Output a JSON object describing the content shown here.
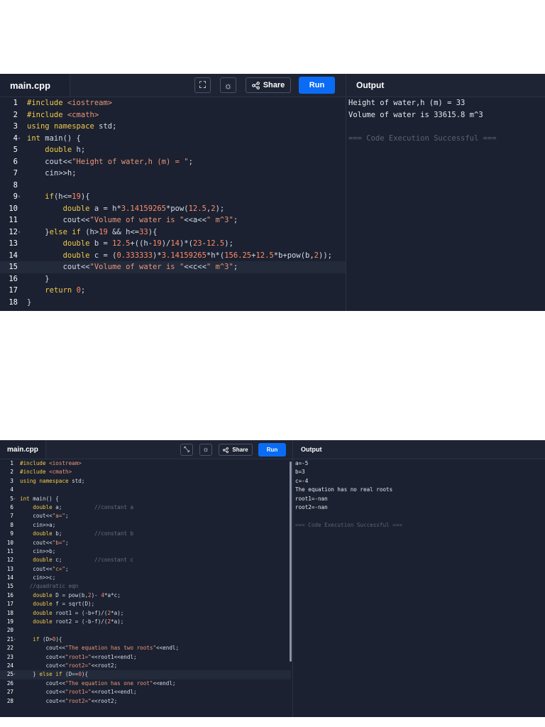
{
  "screens": [
    {
      "tab_label": "main.cpp",
      "share_label": "Share",
      "run_label": "Run",
      "output_title": "Output",
      "icons": [
        "fullscreen-icon",
        "theme-icon",
        "share-icon"
      ],
      "code_lines": [
        "#include <iostream>",
        "#include <cmath>",
        "using namespace std;",
        "int main() {",
        "    double h;",
        "    cout<<\"Height of water,h (m) = \";",
        "    cin>>h;",
        "",
        "    if(h<=19){",
        "        double a = h*3.14159265*pow(12.5,2);",
        "        cout<<\"Volume of water is \"<<a<<\" m^3\";",
        "    }else if (h>19 && h<=33){",
        "        double b = 12.5+((h-19)/14)*(23-12.5);",
        "        double c = (0.333333)*3.14159265*h*(156.25+12.5*b+pow(b,2));",
        "        cout<<\"Volume of water is \"<<c<<\" m^3\";",
        "    }",
        "    return 0;",
        "}"
      ],
      "fold_lines": [
        4,
        9,
        12
      ],
      "active_line": 15,
      "output_lines": [
        "Height of water,h (m) = 33",
        "Volume of water is 33615.8 m^3",
        "",
        "=== Code Execution Successful ==="
      ]
    },
    {
      "tab_label": "main.cpp",
      "share_label": "Share",
      "run_label": "Run",
      "output_title": "Output",
      "icons": [
        "exit-fullscreen-icon",
        "theme-icon",
        "share-icon"
      ],
      "code_lines": [
        "#include <iostream>",
        "#include <cmath>",
        "using namespace std;",
        "",
        "int main() {",
        "    double a;          //constant a",
        "    cout<<\"a=\";",
        "    cin>>a;",
        "    double b;          //constant b",
        "    cout<<\"b=\";",
        "    cin>>b;",
        "    double c;          //constant c",
        "    cout<<\"c=\";",
        "    cin>>c;",
        "   //quadratic eqn",
        "    double D = pow(b,2)- 4*a*c;",
        "    double f = sqrt(D);",
        "    double root1 = (-b+f)/(2*a);",
        "    double root2 = (-b-f)/(2*a);",
        "",
        "    if (D>0){",
        "        cout<<\"The equation has two roots\"<<endl;",
        "        cout<<\"root1=\"<<root1<<endl;",
        "        cout<<\"root2=\"<<root2;",
        "    } else if (D==0){",
        "        cout<<\"The equation has one root\"<<endl;",
        "        cout<<\"root1=\"<<root1<<endl;",
        "        cout<<\"root2=\"<<root2;"
      ],
      "fold_lines": [
        5,
        21,
        25
      ],
      "active_line": 25,
      "output_lines": [
        "a=-5",
        "b=3",
        "c=-4",
        "The equation has no real roots",
        "root1=-nan",
        "root2=-nan",
        "",
        "=== Code Execution Successful ==="
      ]
    }
  ]
}
